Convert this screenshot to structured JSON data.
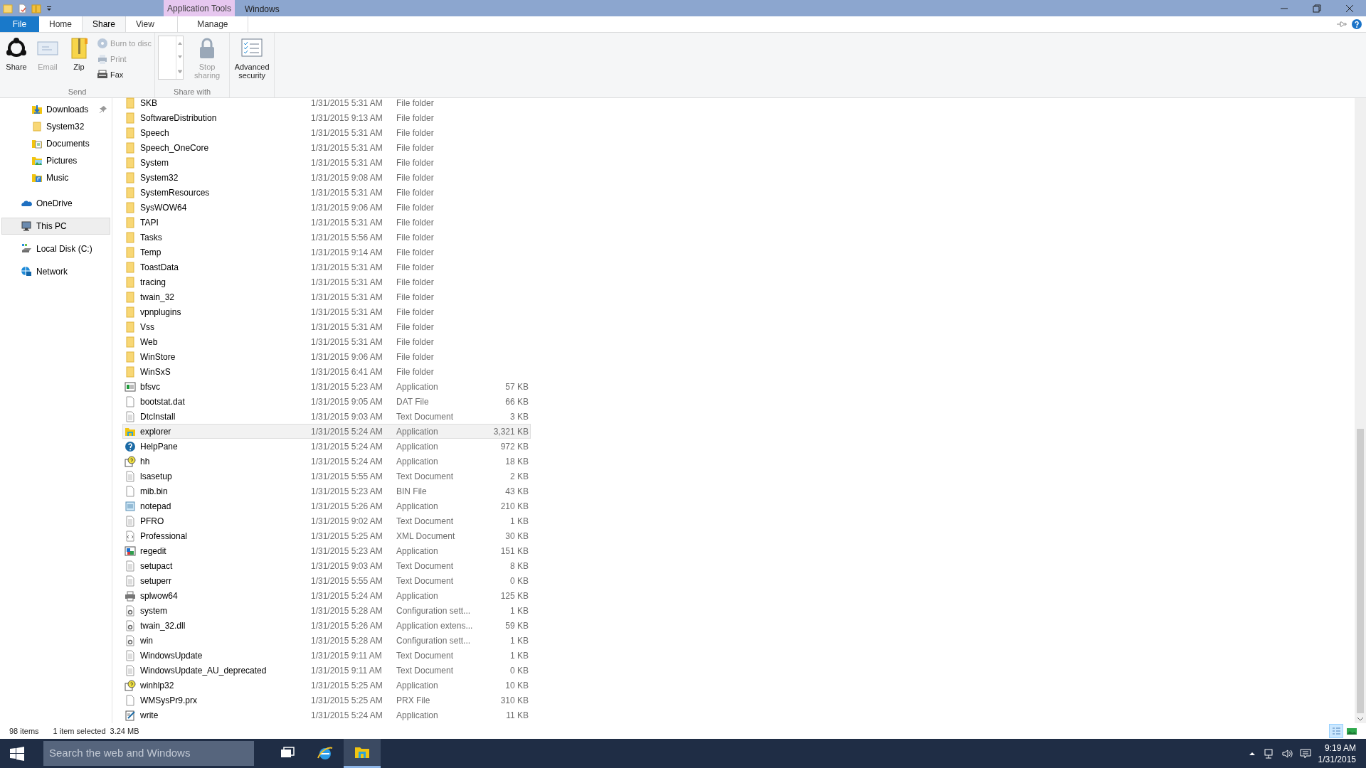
{
  "title_bar": {
    "contextual_tab": "Application Tools",
    "title": "Windows"
  },
  "ribbon_tabs": [
    {
      "label": "File",
      "kind": "file",
      "selected": false
    },
    {
      "label": "Home",
      "kind": "plain",
      "selected": false
    },
    {
      "label": "Share",
      "kind": "plain",
      "selected": true
    },
    {
      "label": "View",
      "kind": "plain",
      "selected": false
    },
    {
      "label": "Manage",
      "kind": "contextual",
      "selected": false
    }
  ],
  "ribbon_groups": [
    {
      "label": "Send",
      "buttons": [
        {
          "label": "Share",
          "kind": "large",
          "disabled": false
        },
        {
          "label": "Email",
          "kind": "large",
          "disabled": true
        },
        {
          "label": "Zip",
          "kind": "large",
          "disabled": false
        },
        {
          "label": "Burn to disc",
          "kind": "small",
          "disabled": true
        },
        {
          "label": "Print",
          "kind": "small",
          "disabled": true
        },
        {
          "label": "Fax",
          "kind": "small",
          "disabled": false
        }
      ]
    },
    {
      "label": "Share with",
      "buttons": [
        {
          "kind": "listbox"
        },
        {
          "label": "Stop sharing",
          "kind": "large",
          "disabled": true
        }
      ]
    },
    {
      "buttons": [
        {
          "label": "Advanced security",
          "kind": "large",
          "disabled": false
        }
      ]
    }
  ],
  "sidebar": {
    "quick_access": [
      {
        "label": "Downloads",
        "kind": "downloads",
        "pinned": true
      },
      {
        "label": "System32",
        "kind": "folder",
        "pinned": false
      },
      {
        "label": "Documents",
        "kind": "documents",
        "pinned": false
      },
      {
        "label": "Pictures",
        "kind": "pictures",
        "pinned": false
      },
      {
        "label": "Music",
        "kind": "music",
        "pinned": false
      }
    ],
    "locations": [
      {
        "label": "OneDrive",
        "kind": "onedrive",
        "selected": false
      },
      {
        "label": "This PC",
        "kind": "pc",
        "selected": true
      },
      {
        "label": "Local Disk (C:)",
        "kind": "disk",
        "selected": false
      },
      {
        "label": "Network",
        "kind": "network",
        "selected": false
      }
    ]
  },
  "files": [
    {
      "name": "SKB",
      "date": "1/31/2015 5:31 AM",
      "type": "File folder",
      "kind": "folder",
      "selected": false
    },
    {
      "name": "SoftwareDistribution",
      "date": "1/31/2015 9:13 AM",
      "type": "File folder",
      "kind": "folder",
      "selected": false
    },
    {
      "name": "Speech",
      "date": "1/31/2015 5:31 AM",
      "type": "File folder",
      "kind": "folder",
      "selected": false
    },
    {
      "name": "Speech_OneCore",
      "date": "1/31/2015 5:31 AM",
      "type": "File folder",
      "kind": "folder",
      "selected": false
    },
    {
      "name": "System",
      "date": "1/31/2015 5:31 AM",
      "type": "File folder",
      "kind": "folder",
      "selected": false
    },
    {
      "name": "System32",
      "date": "1/31/2015 9:08 AM",
      "type": "File folder",
      "kind": "folder",
      "selected": false
    },
    {
      "name": "SystemResources",
      "date": "1/31/2015 5:31 AM",
      "type": "File folder",
      "kind": "folder",
      "selected": false
    },
    {
      "name": "SysWOW64",
      "date": "1/31/2015 9:06 AM",
      "type": "File folder",
      "kind": "folder",
      "selected": false
    },
    {
      "name": "TAPI",
      "date": "1/31/2015 5:31 AM",
      "type": "File folder",
      "kind": "folder",
      "selected": false
    },
    {
      "name": "Tasks",
      "date": "1/31/2015 5:56 AM",
      "type": "File folder",
      "kind": "folder",
      "selected": false
    },
    {
      "name": "Temp",
      "date": "1/31/2015 9:14 AM",
      "type": "File folder",
      "kind": "folder",
      "selected": false
    },
    {
      "name": "ToastData",
      "date": "1/31/2015 5:31 AM",
      "type": "File folder",
      "kind": "folder",
      "selected": false
    },
    {
      "name": "tracing",
      "date": "1/31/2015 5:31 AM",
      "type": "File folder",
      "kind": "folder",
      "selected": false
    },
    {
      "name": "twain_32",
      "date": "1/31/2015 5:31 AM",
      "type": "File folder",
      "kind": "folder",
      "selected": false
    },
    {
      "name": "vpnplugins",
      "date": "1/31/2015 5:31 AM",
      "type": "File folder",
      "kind": "folder",
      "selected": false
    },
    {
      "name": "Vss",
      "date": "1/31/2015 5:31 AM",
      "type": "File folder",
      "kind": "folder",
      "selected": false
    },
    {
      "name": "Web",
      "date": "1/31/2015 5:31 AM",
      "type": "File folder",
      "kind": "folder",
      "selected": false
    },
    {
      "name": "WinStore",
      "date": "1/31/2015 9:06 AM",
      "type": "File folder",
      "kind": "folder",
      "selected": false
    },
    {
      "name": "WinSxS",
      "date": "1/31/2015 6:41 AM",
      "type": "File folder",
      "kind": "folder",
      "selected": false
    },
    {
      "name": "bfsvc",
      "date": "1/31/2015 5:23 AM",
      "type": "Application",
      "size": "57 KB",
      "kind": "app",
      "selected": false
    },
    {
      "name": "bootstat.dat",
      "date": "1/31/2015 9:05 AM",
      "type": "DAT File",
      "size": "66 KB",
      "kind": "file",
      "selected": false
    },
    {
      "name": "DtcInstall",
      "date": "1/31/2015 9:03 AM",
      "type": "Text Document",
      "size": "3 KB",
      "kind": "text",
      "selected": false
    },
    {
      "name": "explorer",
      "date": "1/31/2015 5:24 AM",
      "type": "Application",
      "size": "3,321 KB",
      "kind": "explorer",
      "selected": true
    },
    {
      "name": "HelpPane",
      "date": "1/31/2015 5:24 AM",
      "type": "Application",
      "size": "972 KB",
      "kind": "help",
      "selected": false
    },
    {
      "name": "hh",
      "date": "1/31/2015 5:24 AM",
      "type": "Application",
      "size": "18 KB",
      "kind": "helpdoc",
      "selected": false
    },
    {
      "name": "lsasetup",
      "date": "1/31/2015 5:55 AM",
      "type": "Text Document",
      "size": "2 KB",
      "kind": "text",
      "selected": false
    },
    {
      "name": "mib.bin",
      "date": "1/31/2015 5:23 AM",
      "type": "BIN File",
      "size": "43 KB",
      "kind": "file",
      "selected": false
    },
    {
      "name": "notepad",
      "date": "1/31/2015 5:26 AM",
      "type": "Application",
      "size": "210 KB",
      "kind": "notepad",
      "selected": false
    },
    {
      "name": "PFRO",
      "date": "1/31/2015 9:02 AM",
      "type": "Text Document",
      "size": "1 KB",
      "kind": "text",
      "selected": false
    },
    {
      "name": "Professional",
      "date": "1/31/2015 5:25 AM",
      "type": "XML Document",
      "size": "30 KB",
      "kind": "xml",
      "selected": false
    },
    {
      "name": "regedit",
      "date": "1/31/2015 5:23 AM",
      "type": "Application",
      "size": "151 KB",
      "kind": "regedit",
      "selected": false
    },
    {
      "name": "setupact",
      "date": "1/31/2015 9:03 AM",
      "type": "Text Document",
      "size": "8 KB",
      "kind": "text",
      "selected": false
    },
    {
      "name": "setuperr",
      "date": "1/31/2015 5:55 AM",
      "type": "Text Document",
      "size": "0 KB",
      "kind": "text",
      "selected": false
    },
    {
      "name": "splwow64",
      "date": "1/31/2015 5:24 AM",
      "type": "Application",
      "size": "125 KB",
      "kind": "printer",
      "selected": false
    },
    {
      "name": "system",
      "date": "1/31/2015 5:28 AM",
      "type": "Configuration sett...",
      "size": "1 KB",
      "kind": "config",
      "selected": false
    },
    {
      "name": "twain_32.dll",
      "date": "1/31/2015 5:26 AM",
      "type": "Application extens...",
      "size": "59 KB",
      "kind": "config",
      "selected": false
    },
    {
      "name": "win",
      "date": "1/31/2015 5:28 AM",
      "type": "Configuration sett...",
      "size": "1 KB",
      "kind": "config",
      "selected": false
    },
    {
      "name": "WindowsUpdate",
      "date": "1/31/2015 9:11 AM",
      "type": "Text Document",
      "size": "1 KB",
      "kind": "text",
      "selected": false
    },
    {
      "name": "WindowsUpdate_AU_deprecated",
      "date": "1/31/2015 9:11 AM",
      "type": "Text Document",
      "size": "0 KB",
      "kind": "text",
      "selected": false
    },
    {
      "name": "winhlp32",
      "date": "1/31/2015 5:25 AM",
      "type": "Application",
      "size": "10 KB",
      "kind": "helpdoc",
      "selected": false
    },
    {
      "name": "WMSysPr9.prx",
      "date": "1/31/2015 5:25 AM",
      "type": "PRX File",
      "size": "310 KB",
      "kind": "file",
      "selected": false
    },
    {
      "name": "write",
      "date": "1/31/2015 5:24 AM",
      "type": "Application",
      "size": "11 KB",
      "kind": "write",
      "selected": false
    }
  ],
  "status_bar": {
    "item_count": "98 items",
    "selection": "1 item selected",
    "selection_size": "3.24 MB"
  },
  "view_buttons": [
    {
      "kind": "details",
      "selected": true
    },
    {
      "kind": "large_icons",
      "selected": false
    }
  ],
  "taskbar": {
    "search_placeholder": "Search the web and Windows",
    "apps": [
      {
        "kind": "task_view",
        "active": false
      },
      {
        "kind": "browser",
        "active": false
      },
      {
        "kind": "explorer",
        "active": true
      }
    ],
    "time": "9:19 AM",
    "date": "1/31/2015"
  }
}
